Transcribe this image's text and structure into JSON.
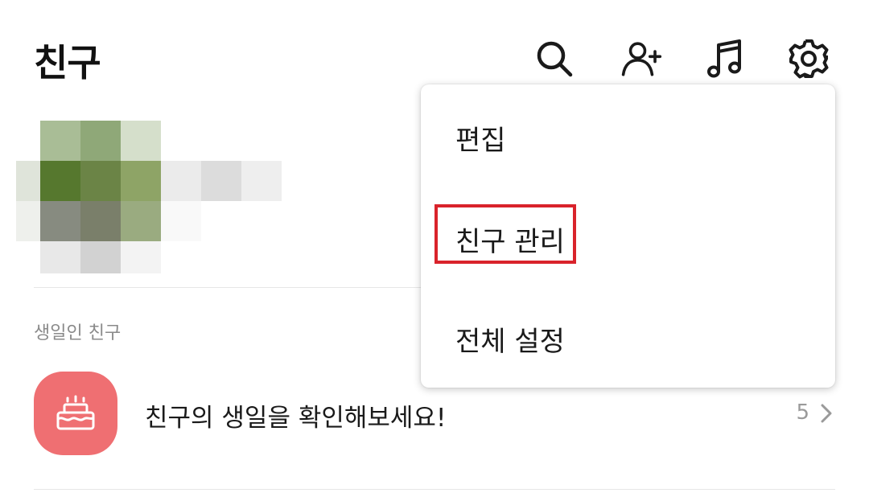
{
  "header": {
    "title": "친구",
    "icons": [
      "search-icon",
      "add-friend-icon",
      "music-icon",
      "settings-icon"
    ]
  },
  "profile": {
    "avatar": "pixelated-profile-image"
  },
  "birthday_section": {
    "label": "생일인 친구",
    "row_text": "친구의 생일을 확인해보세요!",
    "count": "5",
    "icon": "cake-icon",
    "icon_color": "#ef6f72"
  },
  "menu": {
    "items": [
      {
        "label": "편집"
      },
      {
        "label": "친구 관리"
      },
      {
        "label": "전체 설정"
      }
    ],
    "highlight_color": "#d9232b"
  }
}
